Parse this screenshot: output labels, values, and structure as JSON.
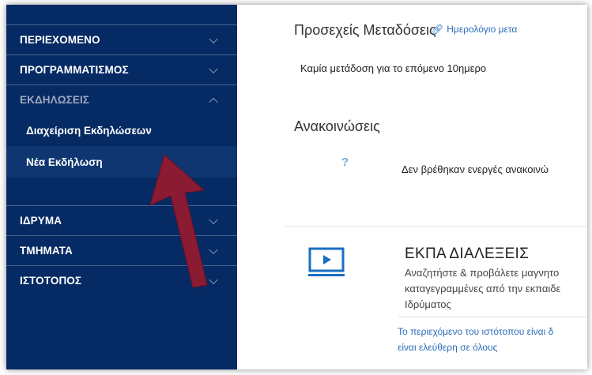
{
  "sidebar": {
    "group1": [
      {
        "label": "ΠΕΡΙΕΧΟΜΕΝΟ"
      },
      {
        "label": "ΠΡΟΓΡΑΜΜΑΤΙΣΜΟΣ"
      },
      {
        "label": "ΕΚΔΗΛΩΣΕΙΣ"
      }
    ],
    "subitems": [
      {
        "label": "Διαχείριση Εκδηλώσεων"
      },
      {
        "label": "Νέα Εκδήλωση"
      }
    ],
    "group2": [
      {
        "label": "ΙΔΡΥΜΑ"
      },
      {
        "label": "ΤΜΗΜΑΤΑ"
      },
      {
        "label": "ΙΣΤΟΤΟΠΟΣ"
      }
    ]
  },
  "broadcasts": {
    "title": "Προσεχείς Μεταδόσεις",
    "link": "Ημερολόγιο μετα",
    "empty": "Καμία μετάδοση για το επόμενο 10ημερο"
  },
  "announcements": {
    "title": "Ανακοινώσεις",
    "icon": "?",
    "empty": "Δεν βρέθηκαν ενεργές ανακοινώ"
  },
  "card": {
    "title": "ΕΚΠΑ ΔΙΑΛΕΞΕΙΣ",
    "desc_line1": "Αναζητήστε & προβάλετε μαγνητο",
    "desc_line2": "καταγεγραμμένες από την εκπαιδε",
    "desc_line3": "Ιδρύματος",
    "footer_line1": "Το περιεχόμενο του ιστότοπου είναι δ",
    "footer_line2": "είναι ελεύθερη σε όλους"
  },
  "colors": {
    "sidebar_bg": "#062a63",
    "arrow": "#8b1a33",
    "link": "#2a6ebb"
  }
}
